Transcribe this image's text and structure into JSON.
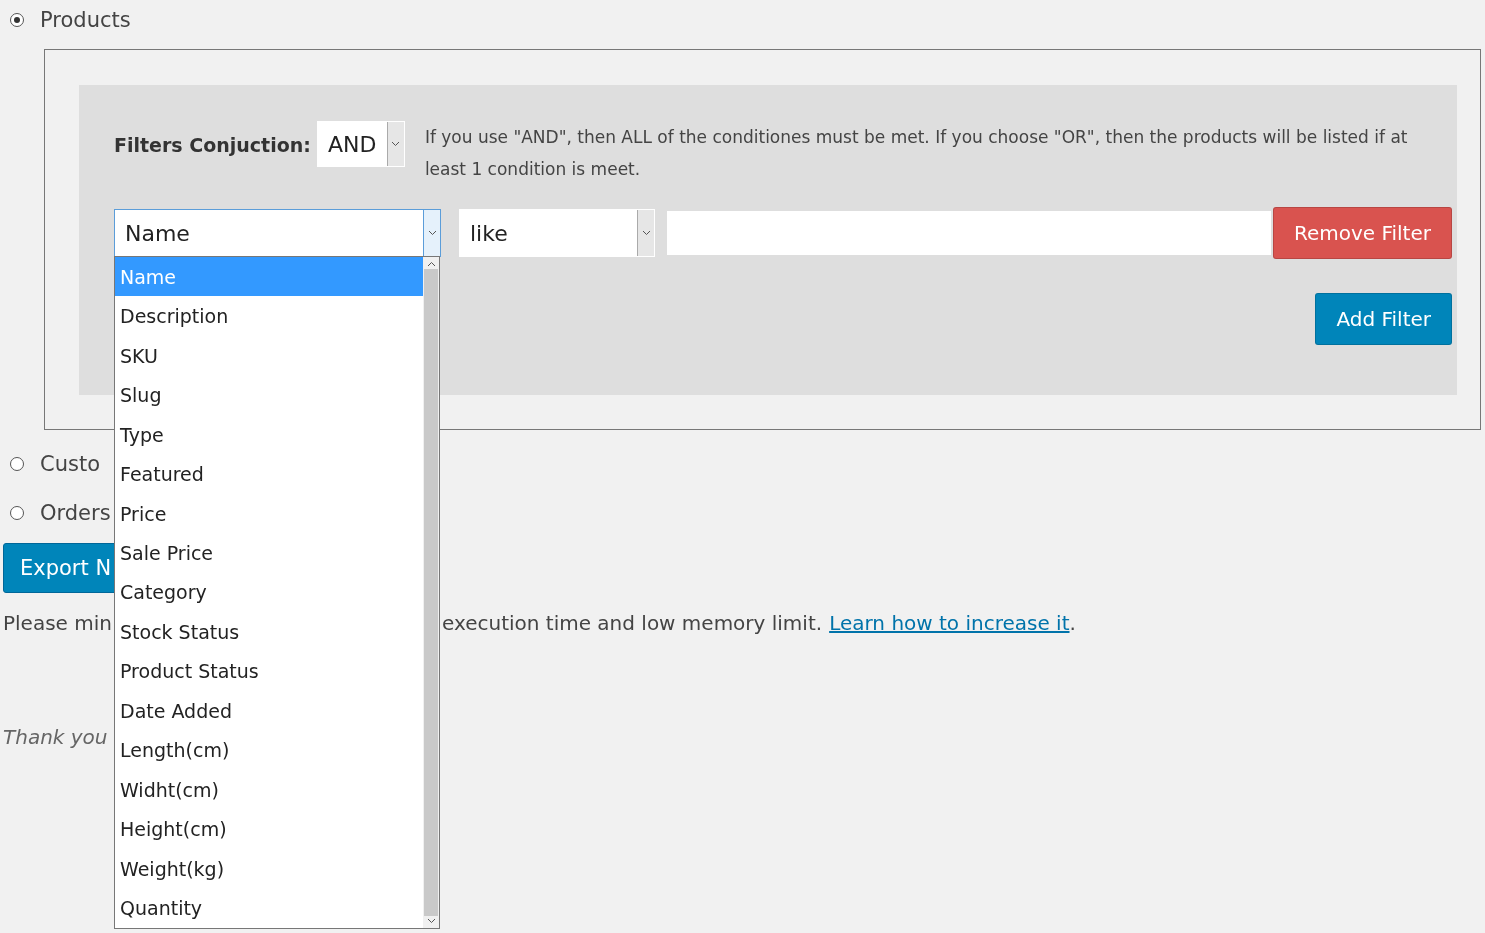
{
  "export_types": [
    {
      "label": "Products",
      "selected": true
    },
    {
      "label": "Custo",
      "selected": false
    },
    {
      "label": "Orders",
      "selected": false
    }
  ],
  "filters": {
    "conjunction_label": "Filters Conjuction:",
    "conjunction_value": "AND",
    "help_text": "If you use \"AND\", then ALL of the conditiones must be met. If you choose \"OR\", then the products will be listed if at least 1 condition is meet.",
    "rows": [
      {
        "field": "Name",
        "operator": "like",
        "value": "",
        "remove_button": "Remove Filter"
      }
    ],
    "add_button": "Add Filter",
    "field_dropdown": {
      "expanded": true,
      "options": [
        {
          "label": "Name",
          "selected": true
        },
        {
          "label": "Description",
          "selected": false
        },
        {
          "label": "SKU",
          "selected": false
        },
        {
          "label": "Slug",
          "selected": false
        },
        {
          "label": "Type",
          "selected": false
        },
        {
          "label": "Featured",
          "selected": false
        },
        {
          "label": "Price",
          "selected": false
        },
        {
          "label": "Sale Price",
          "selected": false
        },
        {
          "label": "Category",
          "selected": false
        },
        {
          "label": "Stock Status",
          "selected": false
        },
        {
          "label": "Product Status",
          "selected": false
        },
        {
          "label": "Date Added",
          "selected": false
        },
        {
          "label": "Length(cm)",
          "selected": false
        },
        {
          "label": "Widht(cm)",
          "selected": false
        },
        {
          "label": "Height(cm)",
          "selected": false
        },
        {
          "label": "Weight(kg)",
          "selected": false
        },
        {
          "label": "Quantity",
          "selected": false
        }
      ]
    }
  },
  "export_button": "Export N",
  "notice": {
    "start": "Please min",
    "end": "execution time and low memory limit.",
    "link": "Learn how to increase it",
    "tail": "."
  },
  "thanks": "Thank you"
}
